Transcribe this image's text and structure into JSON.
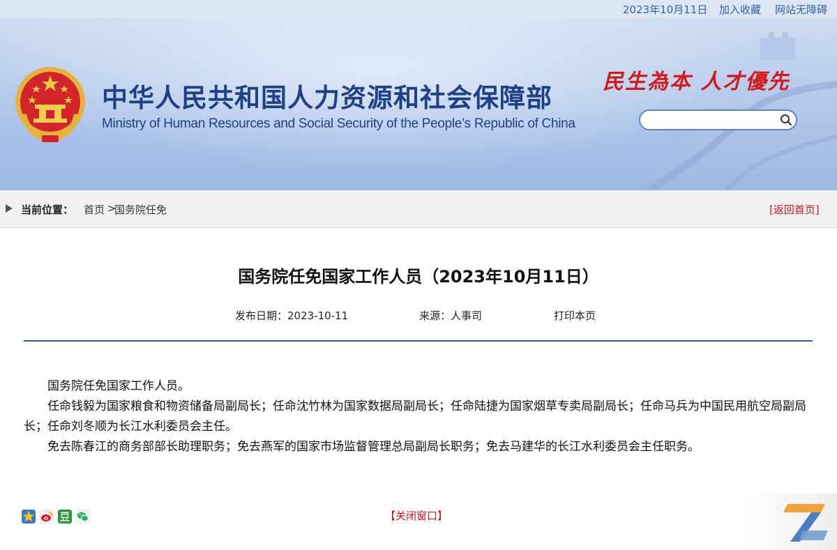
{
  "topbar": {
    "date": "2023年10月11日",
    "add_favorite": "加入收藏",
    "accessibility": "网站无障碍"
  },
  "header": {
    "title_cn": "中华人民共和国人力资源和社会保障部",
    "title_en": "Ministry of Human Resources and Social Security of the People’s Republic of China",
    "slogan": "民生為本 人才優先",
    "search_placeholder": ""
  },
  "breadcrumb": {
    "label": "当前位置：",
    "home": "首页",
    "separator": ">",
    "section": "国务院任免",
    "back_home": "[返回首页]"
  },
  "article": {
    "title": "国务院任免国家工作人员（2023年10月11日）",
    "publish_date": "发布日期：2023-10-11",
    "source": "来源：人事司",
    "print": "打印本页",
    "paragraphs": [
      "国务院任免国家工作人员。",
      "任命钱毅为国家粮食和物资储备局副局长；任命沈竹林为国家数据局副局长；任命陆捷为国家烟草专卖局副局长；任命马兵为中国民用航空局副局长；任命刘冬顺为长江水利委员会主任。",
      "免去陈春江的商务部部长助理职务；免去燕军的国家市场监督管理总局副局长职务；免去马建华的长江水利委员会主任职务。"
    ]
  },
  "footer": {
    "close_window": "【关闭窗口】",
    "share_icons": [
      "qzone-icon",
      "weibo-icon",
      "douban-icon",
      "wechat-icon"
    ]
  },
  "colors": {
    "brand_blue": "#1f3f86",
    "accent_red": "#c8161d",
    "rule_blue": "#2f5ca6"
  }
}
